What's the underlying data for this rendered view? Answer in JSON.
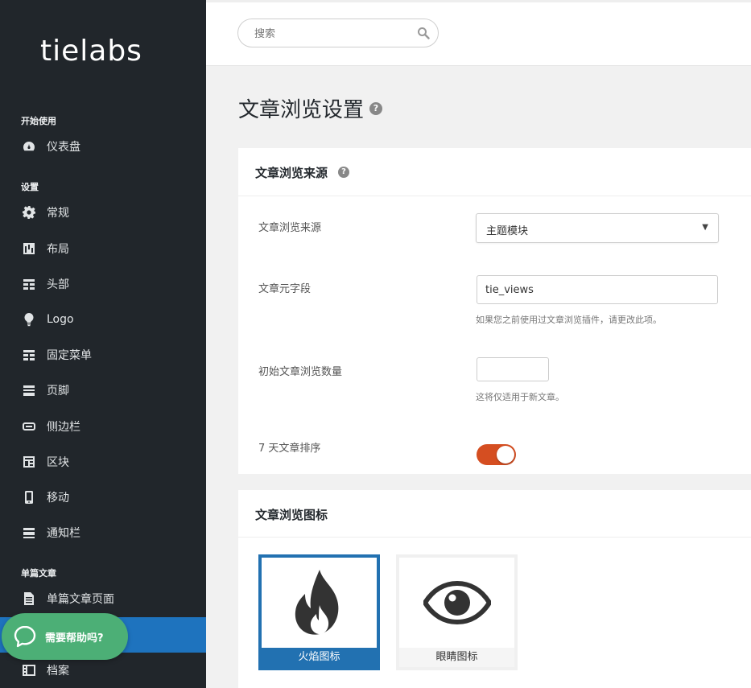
{
  "brand": {
    "name": "tielabs"
  },
  "sidebar": {
    "sections": [
      {
        "heading": "开始使用"
      },
      {
        "heading": "设置"
      },
      {
        "heading": "单篇文章"
      }
    ],
    "items": [
      {
        "label": "仪表盘",
        "icon": "dashboard-icon"
      },
      {
        "label": "常规",
        "icon": "gear-icon"
      },
      {
        "label": "布局",
        "icon": "layout-icon"
      },
      {
        "label": "头部",
        "icon": "header-icon"
      },
      {
        "label": "Logo",
        "icon": "lightbulb-icon"
      },
      {
        "label": "固定菜单",
        "icon": "sticky-menu-icon"
      },
      {
        "label": "页脚",
        "icon": "footer-icon"
      },
      {
        "label": "侧边栏",
        "icon": "sidebar-icon"
      },
      {
        "label": "区块",
        "icon": "blocks-icon"
      },
      {
        "label": "移动",
        "icon": "mobile-icon"
      },
      {
        "label": "通知栏",
        "icon": "notification-bar-icon"
      },
      {
        "label": "单篇文章页面",
        "icon": "document-icon"
      },
      {
        "label": "",
        "icon": "active-item"
      },
      {
        "label": "档案",
        "icon": "archive-icon"
      }
    ]
  },
  "help": {
    "label": "需要帮助吗?"
  },
  "search": {
    "placeholder": "搜索"
  },
  "page": {
    "title": "文章浏览设置"
  },
  "panel_source": {
    "title": "文章浏览来源",
    "fields": {
      "source_label": "文章浏览来源",
      "source_value": "主题模块",
      "meta_label": "文章元字段",
      "meta_value": "tie_views",
      "meta_hint": "如果您之前使用过文章浏览插件，请更改此项。",
      "initial_label": "初始文章浏览数量",
      "initial_value": "",
      "initial_hint": "这将仅适用于新文章。",
      "sort_label": "7 天文章排序",
      "sort_enabled": true
    }
  },
  "panel_icon": {
    "title": "文章浏览图标",
    "options": [
      {
        "label": "火焰图标",
        "icon": "flame-icon",
        "selected": true
      },
      {
        "label": "眼睛图标",
        "icon": "eye-icon",
        "selected": false
      }
    ]
  },
  "colors": {
    "sidebar_bg": "#21262b",
    "active_blue": "#1e73be",
    "toggle_on": "#d54e21",
    "help_green": "#4caf76"
  }
}
